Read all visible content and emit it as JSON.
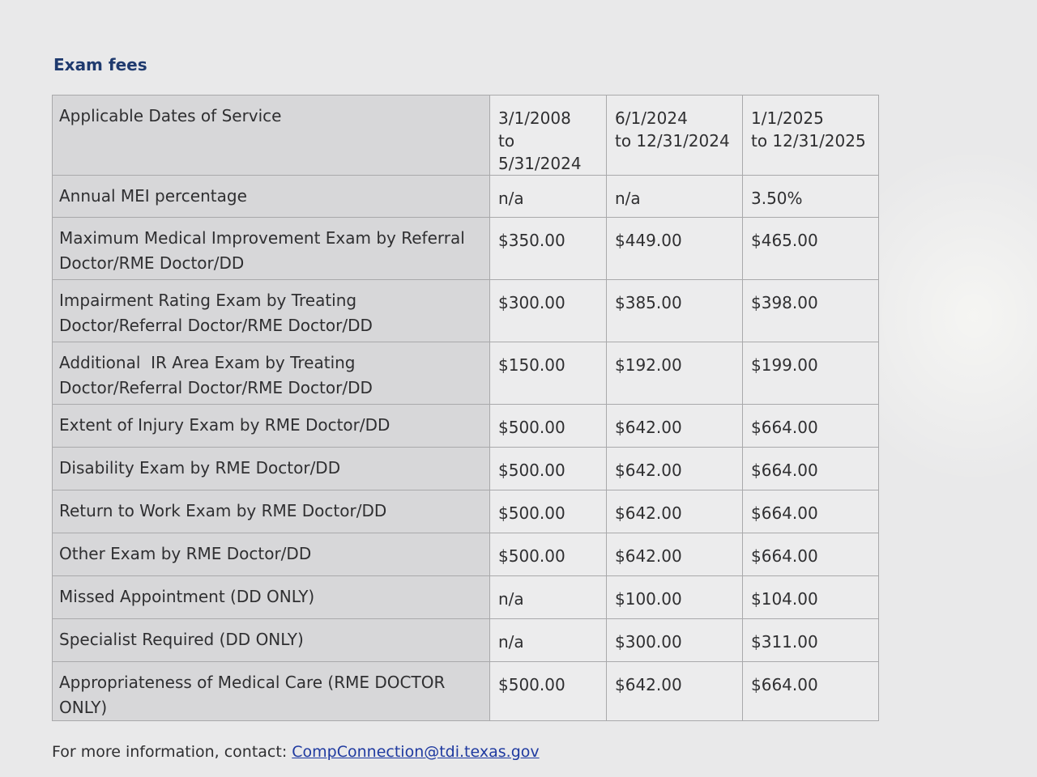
{
  "section": {
    "title": "Exam fees"
  },
  "table": {
    "header": {
      "label": "Applicable Dates of Service",
      "periods": [
        {
          "line1": "3/1/2008",
          "line2": "to 5/31/2024"
        },
        {
          "line1": "6/1/2024",
          "line2": "to 12/31/2024"
        },
        {
          "line1": "1/1/2025",
          "line2": "to 12/31/2025"
        }
      ]
    },
    "rows": [
      {
        "label": "Annual MEI percentage",
        "values": [
          "n/a",
          "n/a",
          "3.50%"
        ]
      },
      {
        "label": "Maximum Medical Improvement Exam by Referral Doctor/RME Doctor/DD",
        "values": [
          "$350.00",
          "$449.00",
          "$465.00"
        ]
      },
      {
        "label": "Impairment Rating Exam by Treating Doctor/Referral Doctor/RME Doctor/DD",
        "values": [
          "$300.00",
          "$385.00",
          "$398.00"
        ]
      },
      {
        "label": "Additional  IR Area Exam by Treating Doctor/Referral Doctor/RME Doctor/DD",
        "values": [
          "$150.00",
          "$192.00",
          "$199.00"
        ]
      },
      {
        "label": "Extent of Injury Exam by RME Doctor/DD",
        "values": [
          "$500.00",
          "$642.00",
          "$664.00"
        ]
      },
      {
        "label": "Disability Exam by RME Doctor/DD",
        "values": [
          "$500.00",
          "$642.00",
          "$664.00"
        ]
      },
      {
        "label": "Return to Work Exam by RME Doctor/DD",
        "values": [
          "$500.00",
          "$642.00",
          "$664.00"
        ]
      },
      {
        "label": "Other Exam by RME Doctor/DD",
        "values": [
          "$500.00",
          "$642.00",
          "$664.00"
        ]
      },
      {
        "label": "Missed Appointment (DD ONLY)",
        "values": [
          "n/a",
          "$100.00",
          "$104.00"
        ]
      },
      {
        "label": "Specialist Required (DD ONLY)",
        "values": [
          "n/a",
          "$300.00",
          "$311.00"
        ]
      },
      {
        "label": "Appropriateness of Medical Care (RME DOCTOR ONLY)",
        "values": [
          "$500.00",
          "$642.00",
          "$664.00"
        ]
      }
    ]
  },
  "footer": {
    "text": "For more information, contact: ",
    "link_text": "CompConnection@tdi.texas.gov"
  }
}
